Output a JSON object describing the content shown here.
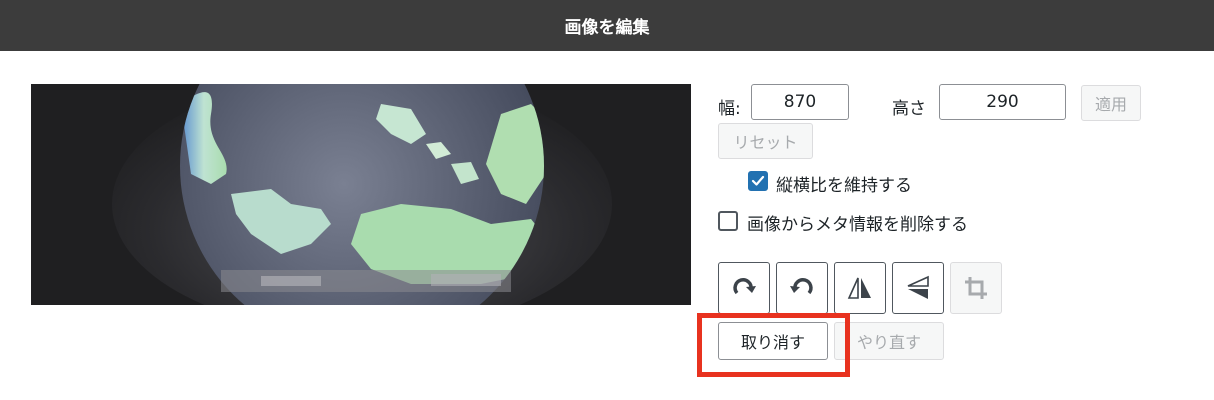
{
  "header": {
    "title": "画像を編集"
  },
  "preview": {
    "alt": "Globe illustration"
  },
  "scale": {
    "width_label": "幅:",
    "width_value": "870",
    "height_label": "高さ",
    "height_value": "290",
    "apply_label": "適用",
    "reset_label": "リセット"
  },
  "options": {
    "keep_aspect_label": "縦横比を維持する",
    "keep_aspect_checked": true,
    "remove_meta_label": "画像からメタ情報を削除する",
    "remove_meta_checked": false
  },
  "tools": {
    "rotate_right": "rotate-right-icon",
    "rotate_left": "rotate-left-icon",
    "flip_vertical": "flip-vertical-icon",
    "flip_horizontal": "flip-horizontal-icon",
    "crop": "crop-icon"
  },
  "history": {
    "undo_label": "取り消す",
    "redo_label": "やり直す"
  },
  "colors": {
    "header_bg": "#3c3c3c",
    "accent": "#2271b1",
    "highlight": "#e8321f"
  }
}
